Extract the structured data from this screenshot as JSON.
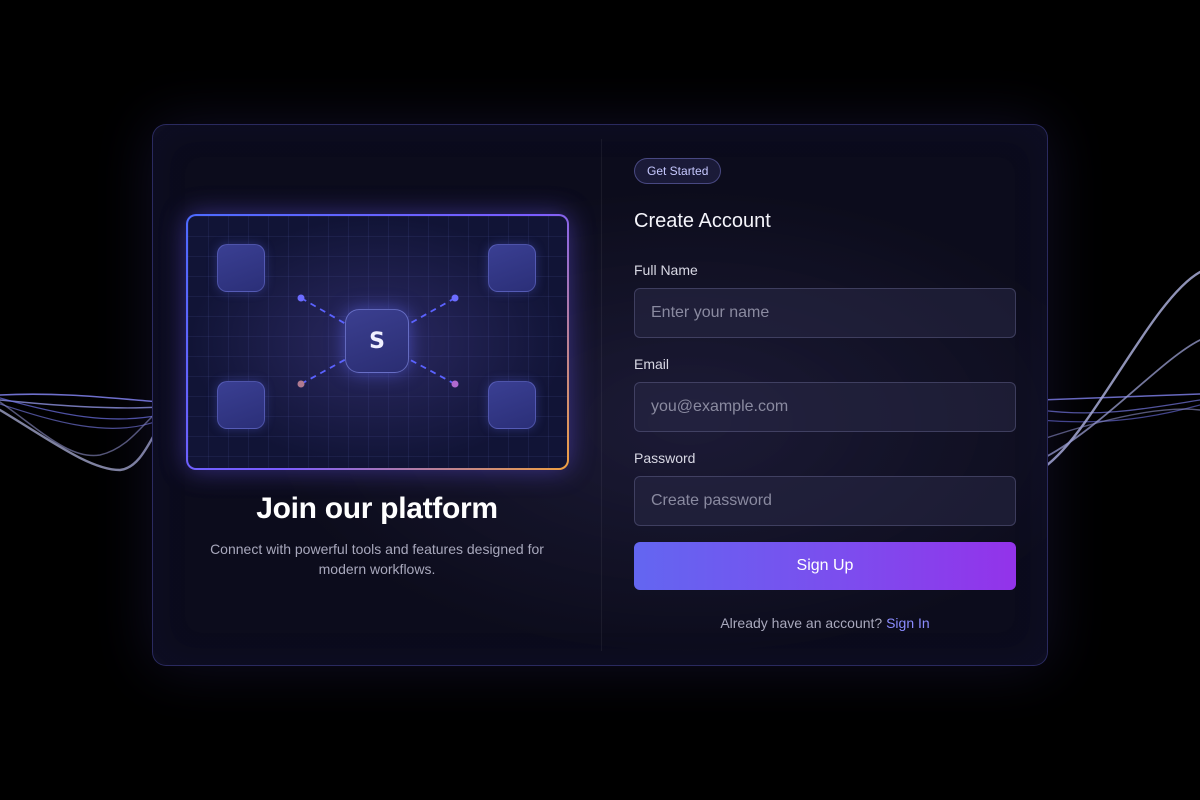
{
  "brand": {
    "logo_letter": "S"
  },
  "left_panel": {
    "title": "Join our platform",
    "subtitle": "Connect with powerful tools and features designed for modern workflows."
  },
  "form": {
    "badge": "Get Started",
    "title": "Create Account",
    "fields": [
      {
        "label": "Full Name",
        "placeholder": "Enter your name",
        "type": "text"
      },
      {
        "label": "Email",
        "placeholder": "you@example.com",
        "type": "email"
      },
      {
        "label": "Password",
        "placeholder": "Create password",
        "type": "password"
      }
    ],
    "submit_label": "Sign Up",
    "footer_text": "Already have an account?",
    "footer_link": "Sign In"
  },
  "colors": {
    "accent_start": "#6366f1",
    "accent_end": "#9333ea",
    "link": "#8b8cff",
    "background": "#000000"
  }
}
